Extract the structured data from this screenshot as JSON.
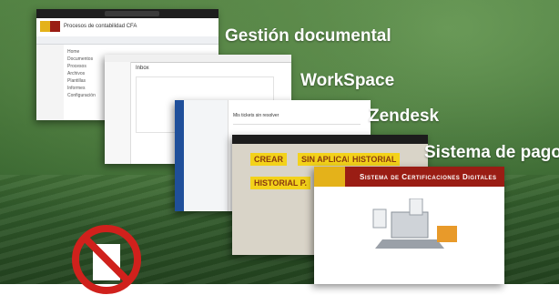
{
  "labels": {
    "gestion": "Gestión documental",
    "workspace": "WorkSpace",
    "zendesk": "Zendesk",
    "pagos": "Sistema de pagos"
  },
  "gestion_shot": {
    "title": "Procesos de contabilidad CFA",
    "items": [
      "Home",
      "Documentos",
      "Procesos",
      "Archivos",
      "Plantillas",
      "Informes",
      "Configuración"
    ]
  },
  "workspace_shot": {
    "title": "Inbox"
  },
  "zendesk_shot": {
    "title": "Mis tickets sin resolver"
  },
  "pagos_shot": {
    "tiles": [
      "CREAR",
      "SIN APLICAR",
      "HISTORIAL",
      "HISTORIAL P."
    ]
  },
  "certificados_shot": {
    "title": "Sistema de Certificaciones Digitales"
  },
  "colors": {
    "label": "#ffffff",
    "brand_red": "#9a1d14",
    "tile_yellow": "#f3d21a",
    "zendesk_nav": "#1f4f9a",
    "no_sign": "#d0211c"
  },
  "icons": [
    "no-paper-icon"
  ]
}
